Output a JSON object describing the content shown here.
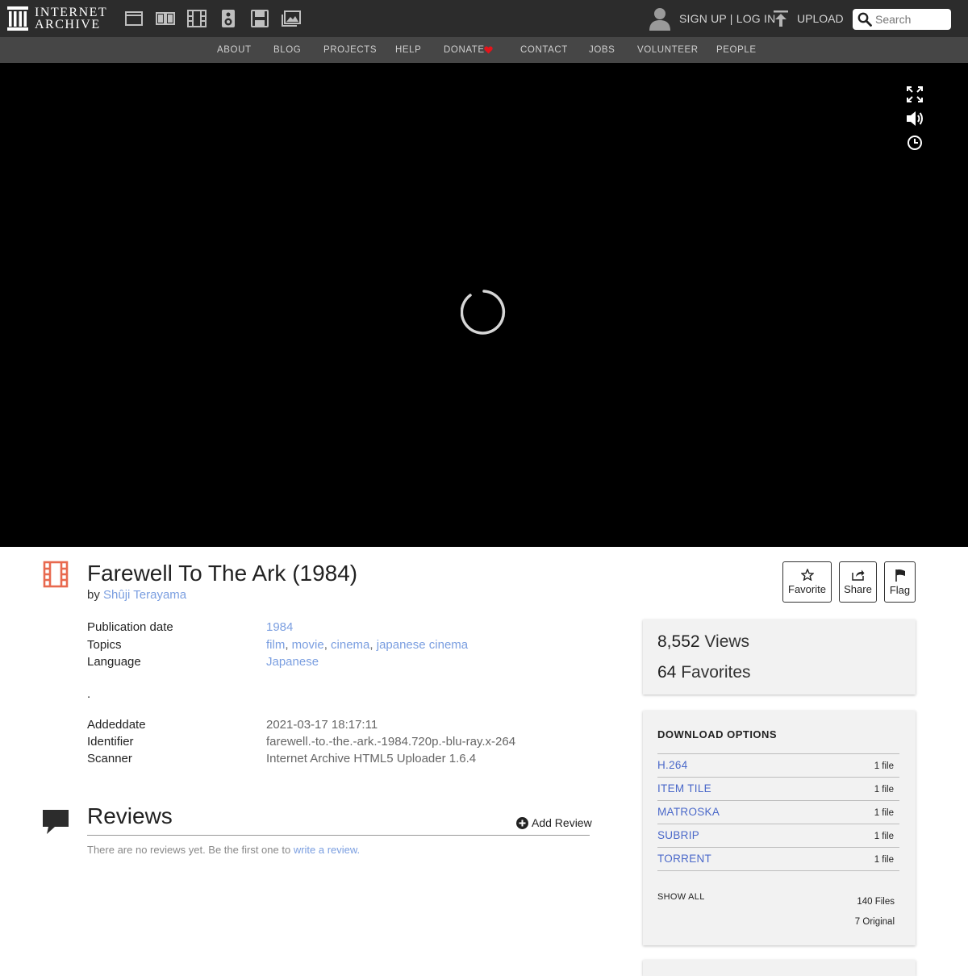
{
  "header": {
    "logo_line1": "INTERNET",
    "logo_line2": "ARCHIVE",
    "media_icons": [
      "web-icon",
      "texts-icon",
      "video-icon",
      "audio-icon",
      "software-icon",
      "images-icon"
    ],
    "user_links": "SIGN UP | LOG IN",
    "upload_label": "UPLOAD",
    "search_placeholder": "Search"
  },
  "nav": {
    "items": [
      "ABOUT",
      "BLOG",
      "PROJECTS",
      "HELP",
      "DONATE",
      "CONTACT",
      "JOBS",
      "VOLUNTEER",
      "PEOPLE"
    ],
    "donate_heart_color": "#e3141b"
  },
  "item": {
    "title": "Farewell To The Ark (1984)",
    "by_label": "by",
    "creator": "Shûji Terayama",
    "icon_color": "#e8694f",
    "actions": [
      "Favorite",
      "Share",
      "Flag"
    ]
  },
  "metadata": {
    "publication_date_label": "Publication date",
    "publication_date": "1984",
    "topics_label": "Topics",
    "topics": [
      "film",
      "movie",
      "cinema",
      "japanese cinema"
    ],
    "topics_sep": ",",
    "language_label": "Language",
    "language": "Japanese",
    "dot": ".",
    "addeddate_label": "Addeddate",
    "addeddate": "2021-03-17 18:17:11",
    "identifier_label": "Identifier",
    "identifier": "farewell.-to.-the.-ark.-1984.720p.-blu-ray.x-264",
    "scanner_label": "Scanner",
    "scanner": "Internet Archive HTML5 Uploader 1.6.4"
  },
  "reviews": {
    "title": "Reviews",
    "add_label": "Add Review",
    "empty_text": "There are no reviews yet. Be the first one to",
    "write_link": "write a review."
  },
  "stats": {
    "views_count": "8,552",
    "views_label": "Views",
    "favorites_count": "64",
    "favorites_label": "Favorites"
  },
  "downloads": {
    "heading": "DOWNLOAD OPTIONS",
    "rows": [
      {
        "format": "H.264",
        "count": "1 file"
      },
      {
        "format": "ITEM TILE",
        "count": "1 file"
      },
      {
        "format": "MATROSKA",
        "count": "1 file"
      },
      {
        "format": "SUBRIP",
        "count": "1 file"
      },
      {
        "format": "TORRENT",
        "count": "1 file"
      }
    ],
    "show_all": "SHOW ALL",
    "total_files": "140 Files",
    "original_files": "7 Original"
  }
}
